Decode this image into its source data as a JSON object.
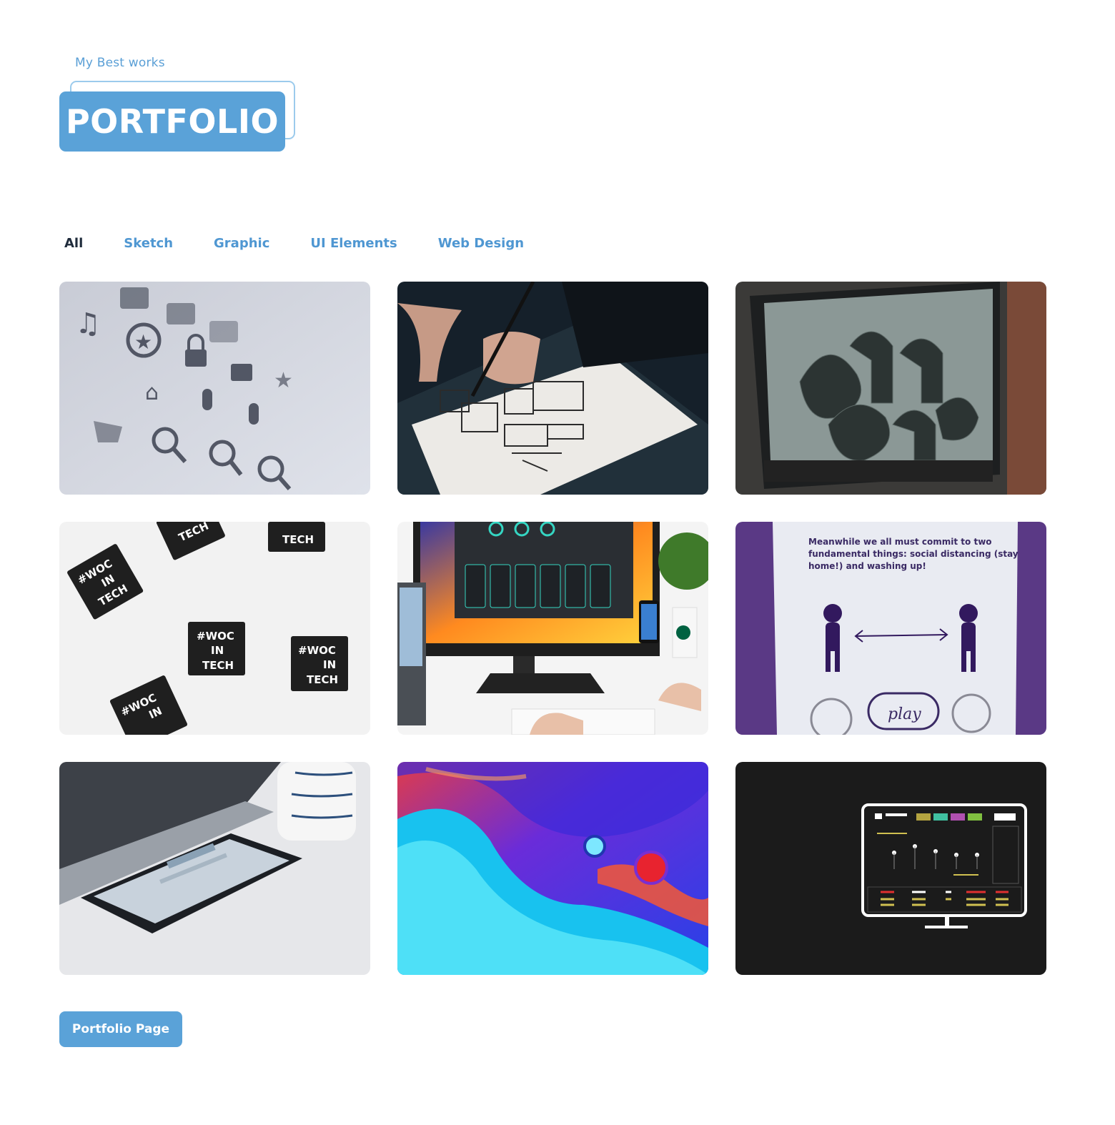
{
  "header": {
    "subtitle": "My Best works",
    "title": "PORTFOLIO"
  },
  "filters": [
    {
      "label": "All",
      "active": true
    },
    {
      "label": "Sketch",
      "active": false
    },
    {
      "label": "Graphic",
      "active": false
    },
    {
      "label": "UI Elements",
      "active": false
    },
    {
      "label": "Web Design",
      "active": false
    }
  ],
  "portfolio_items": [
    {
      "name": "icons-sheet",
      "text_lines": []
    },
    {
      "name": "hand-sketching-wireframe",
      "text_lines": []
    },
    {
      "name": "3d-typography-monitor",
      "text_lines": []
    },
    {
      "name": "woc-in-tech-stickers",
      "text_lines": [
        "#WOC",
        "IN",
        "TECH"
      ]
    },
    {
      "name": "desk-monitor-app-ui",
      "text_lines": []
    },
    {
      "name": "social-distancing-screen",
      "text_lines": [
        "Meanwhile we all must commit to two",
        "fundamental things: social distancing (stay",
        "home!) and washing up!",
        "play"
      ]
    },
    {
      "name": "phone-on-desk",
      "text_lines": []
    },
    {
      "name": "fluid-abstract-art",
      "text_lines": []
    },
    {
      "name": "dashboard-monitor-icon",
      "text_lines": []
    }
  ],
  "footer": {
    "button_label": "Portfolio Page"
  },
  "colors": {
    "accent": "#5aa2d8",
    "accent_outline": "#9ccbec",
    "active_filter": "#1f2b3b",
    "filter": "#4f97d2"
  }
}
